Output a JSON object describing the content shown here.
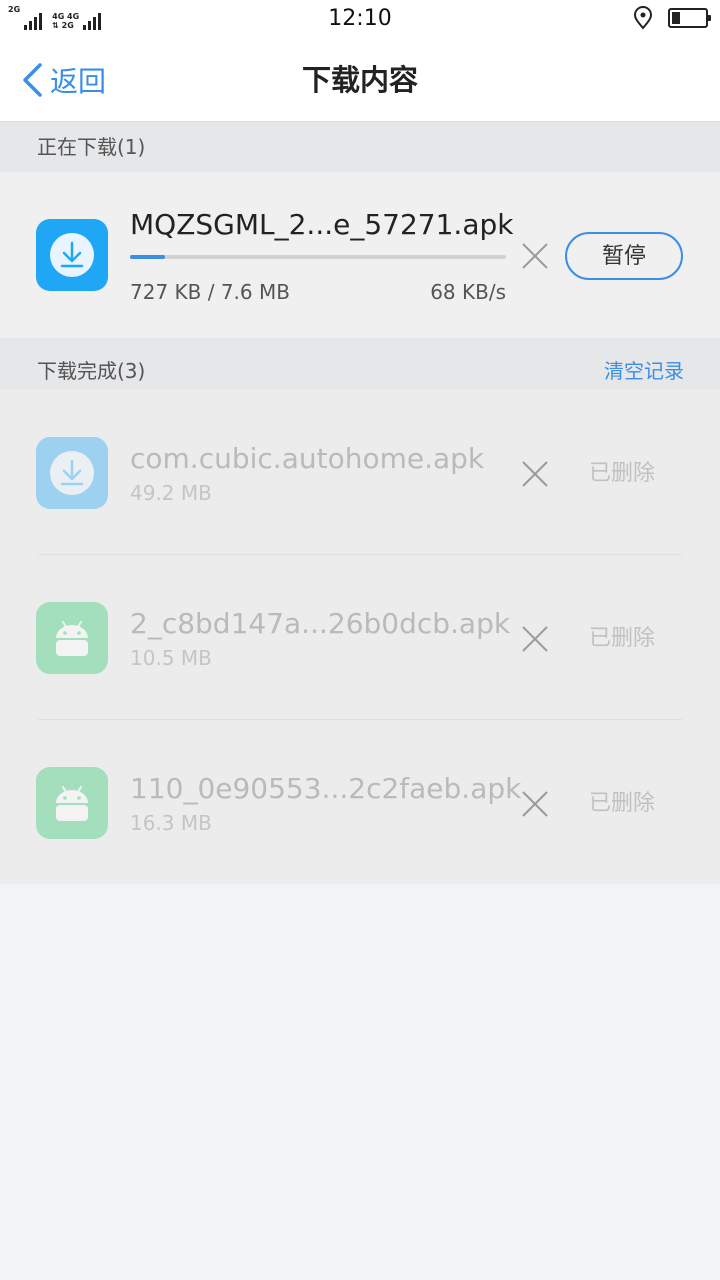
{
  "status_bar": {
    "time": "12:10",
    "sim1": "2G",
    "sim2_top": "4G 4G",
    "sim2_bottom": "2G"
  },
  "nav": {
    "back_label": "返回",
    "title": "下载内容"
  },
  "downloading_section": {
    "title": "正在下载(1)",
    "item": {
      "name": "MQZSGML_2...e_57271.apk",
      "progress_text": "727 KB / 7.6 MB",
      "progress_fraction": 0.094,
      "speed": "68 KB/s",
      "pause_label": "暂停",
      "icon": "download-icon"
    }
  },
  "completed_section": {
    "title": "下载完成(3)",
    "clear_label": "清空记录",
    "items": [
      {
        "name": "com.cubic.autohome.apk",
        "size": "49.2 MB",
        "status": "已删除",
        "icon": "download-icon"
      },
      {
        "name": "2_c8bd147a...26b0dcb.apk",
        "size": "10.5 MB",
        "status": "已删除",
        "icon": "android-icon"
      },
      {
        "name": "110_0e90553...2c2faeb.apk",
        "size": "16.3 MB",
        "status": "已删除",
        "icon": "android-icon"
      }
    ]
  },
  "colors": {
    "accent": "#3a8ee6",
    "download_icon_bg": "#1fa7f5",
    "android_icon_bg": "#2ecc71"
  }
}
